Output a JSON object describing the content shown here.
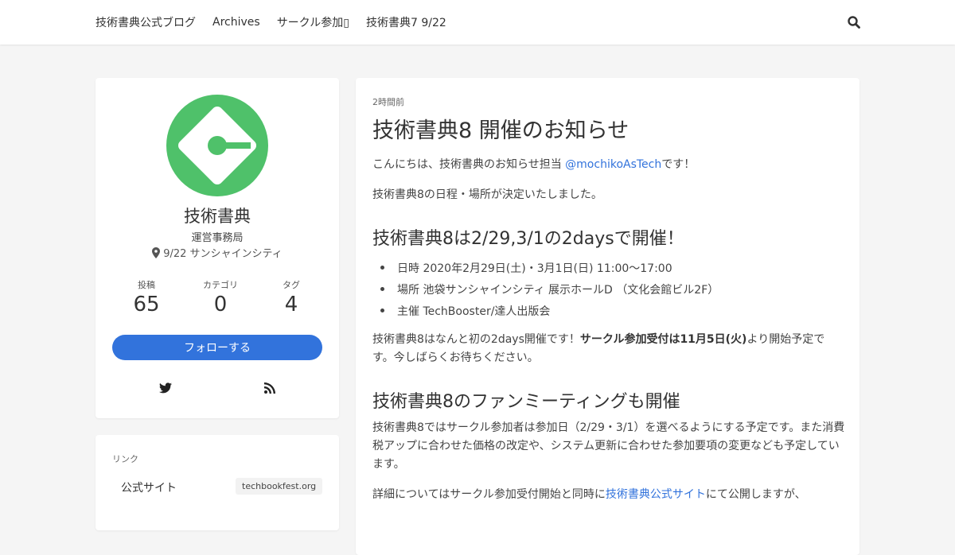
{
  "nav": {
    "items": [
      "技術書典公式ブログ",
      "Archives",
      "サークル参加▯",
      "技術書典7 9/22"
    ],
    "search_icon": "search-icon"
  },
  "profile": {
    "name": "技術書典",
    "subtitle": "運営事務局",
    "location": "9/22 サンシャインシティ",
    "stats": [
      {
        "label": "投稿",
        "value": "65"
      },
      {
        "label": "カテゴリ",
        "value": "0"
      },
      {
        "label": "タグ",
        "value": "4"
      }
    ],
    "follow_label": "フォローする",
    "accent_color": "#3273dc",
    "logo_color": "#4fc16a"
  },
  "links": {
    "title": "リンク",
    "items": [
      {
        "label": "公式サイト",
        "tag": "techbookfest.org"
      }
    ]
  },
  "article": {
    "time": "2時間前",
    "title": "技術書典8 開催のお知らせ",
    "p1_before": "こんにちは、技術書典のお知らせ担当 ",
    "p1_link": "@mochikoAsTech",
    "p1_after": "です！",
    "p2": "技術書典8の日程・場所が決定いたしました。",
    "h2_1": "技術書典8は2/29,3/1の2daysで開催！",
    "list": [
      "日時 2020年2月29日(土)・3月1日(日) 11:00〜17:00",
      "場所 池袋サンシャインシティ 展示ホールD （文化会館ビル2F）",
      "主催 TechBooster/達人出版会"
    ],
    "p3_before": "技術書典8はなんと初の2days開催です！",
    "p3_bold": "サークル参加受付は11月5日(火)",
    "p3_after": "より開始予定です。今しばらくお待ちください。",
    "h2_2": "技術書典8のファンミーティングも開催",
    "p4": "技術書典8ではサークル参加者は参加日（2/29・3/1）を選べるようにする予定です。また消費税アップに合わせた価格の改定や、システム更新に合わせた参加要項の変更なども予定しています。",
    "p5_before": "詳細についてはサークル参加受付開始と同時に",
    "p5_link": "技術書典公式サイト",
    "p5_after": "にて公開しますが、"
  }
}
